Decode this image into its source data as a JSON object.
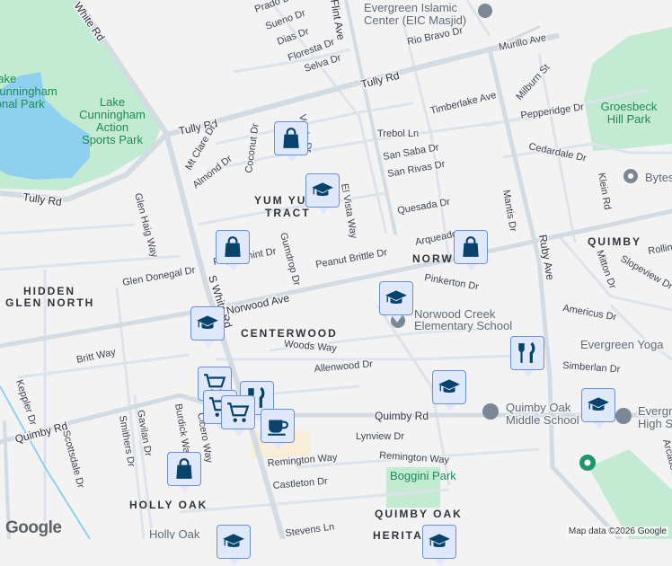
{
  "map": {
    "colors": {
      "background": "#f4f3f4",
      "road": "#d3dbe3",
      "park": "#c3ebd3",
      "water": "#8fd0ef",
      "marker_fill": "#dfe9fb",
      "marker_icon": "#07436a"
    },
    "roads": {
      "white_rd": "White Rd",
      "s_white_rd": "S White Rd",
      "tully_rd_1": "Tully Rd",
      "tully_rd_2": "Tully Rd",
      "tully_rd_3": "Tully Rd",
      "norwood_ave": "Norwood Ave",
      "quimby_rd_1": "Quimby Rd",
      "quimby_rd_2": "Quimby Rd",
      "ruby_ave": "Ruby Ave",
      "flint_ave": "Flint Ave",
      "murillo_ave": "Murillo Ave",
      "rio_bravo_dr": "Rio Bravo Dr",
      "prado_dr": "Prado Dr",
      "sueno_dr": "Sueno Dr",
      "dias_dr": "Dias Dr",
      "floresta_dr": "Floresta Dr",
      "selva_dr": "Selva Dr",
      "milburn_st": "Milburn St",
      "timberlake_ave": "Timberlake Ave",
      "pepperidge_dr": "Pepperidge Dr",
      "trebol_ln": "Trebol Ln",
      "san_saba_dr": "San Saba Dr",
      "cedardale_dr": "Cedardale Dr",
      "san_rivas_dr": "San Rivas Dr",
      "quesada_dr": "Quesada Dr",
      "mantis_dr": "Mantis Dr",
      "klein_rd": "Klein Rd",
      "arqueado": "Arqueado",
      "peanut_brittle_dr": "Peanut Brittle Dr",
      "el_vista_way": "El Vista Way",
      "gumdrop_dr": "Gumdrop Dr",
      "peppermint_dr": "Peppermint Dr",
      "mt_clare_dr": "Mt Clare Dr",
      "almond_dr": "Almond Dr",
      "coconut_dr": "Coconut Dr",
      "verde_dr": "Verde Dr",
      "glen_haig_way": "Glen Haig Way",
      "glen_donegal_dr": "Glen Donegal Dr",
      "britt_way": "Britt Way",
      "woods_way": "Woods Way",
      "allenwood_dr": "Allenwood Dr",
      "pinkerton_dr": "Pinkerton Dr",
      "americus_dr": "Americus Dr",
      "simberlan_dr": "Simberlan Dr",
      "mitton_dr": "Mitton Dr",
      "slopeview_dr": "Slopeview Dr",
      "rolling": "Rollin",
      "keppler_dr": "Keppler Dr",
      "scottsdale_dr": "Scottsdale Dr",
      "smithers_dr": "Smithers Dr",
      "gavilan_dr": "Gavilan Dr",
      "burdick_way": "Burdick Way",
      "cicero_way": "Cicero Way",
      "lynview_dr": "Lynview Dr",
      "remington_way_1": "Remington Way",
      "remington_way_2": "Remington Way",
      "castleton_dr": "Castleton Dr",
      "stevens_ln": "Stevens Ln",
      "arcade": "Arcade Av"
    },
    "areas": {
      "yum_yum_1": "YUM YUM",
      "yum_yum_2": "TRACT",
      "hidden_glen_1": "HIDDEN",
      "hidden_glen_2": "GLEN NORTH",
      "norwood": "NORWOOD",
      "quimby": "QUIMBY",
      "centerwood": "CENTERWOOD",
      "holly_oak": "HOLLY OAK",
      "quimby_oak": "QUIMBY OAK",
      "heritage": "HERITAGE"
    },
    "parks": {
      "lake_cunningham_park_1": "Lake",
      "lake_cunningham_park_2": "Cunningham",
      "lake_cunningham_park_3": "Regional Park",
      "action_1": "Lake",
      "action_2": "Cunningham",
      "action_3": "Action",
      "action_4": "Sports Park",
      "groesbeck_1": "Groesbeck",
      "groesbeck_2": "Hill Park",
      "boggini": "Boggini Park"
    },
    "pois": {
      "eic_1": "Evergreen Islamic",
      "eic_2": "Center (EIC Masjid)",
      "bytes": "Bytes",
      "norwood_creek_1": "Norwood Creek",
      "norwood_creek_2": "Elementary School",
      "evergreen_yoga": "Evergreen Yoga",
      "quimby_oak_ms_1": "Quimby Oak",
      "quimby_oak_ms_2": "Middle School",
      "evergreen_hs_1": "Evergreen",
      "evergreen_hs_2": "High School",
      "holly_oak_poi": "Holly Oak"
    },
    "markers": [
      {
        "type": "shopping-bag"
      },
      {
        "type": "graduation-cap"
      },
      {
        "type": "shopping-bag"
      },
      {
        "type": "shopping-bag"
      },
      {
        "type": "graduation-cap"
      },
      {
        "type": "graduation-cap"
      },
      {
        "type": "shopping-cart"
      },
      {
        "type": "restaurant"
      },
      {
        "type": "shopping-cart"
      },
      {
        "type": "shopping-cart"
      },
      {
        "type": "coffee-cup"
      },
      {
        "type": "restaurant"
      },
      {
        "type": "graduation-cap"
      },
      {
        "type": "graduation-cap"
      },
      {
        "type": "shopping-bag"
      },
      {
        "type": "graduation-cap"
      },
      {
        "type": "graduation-cap"
      }
    ],
    "logo": "Google",
    "attribution": "Map data ©2026 Google"
  }
}
